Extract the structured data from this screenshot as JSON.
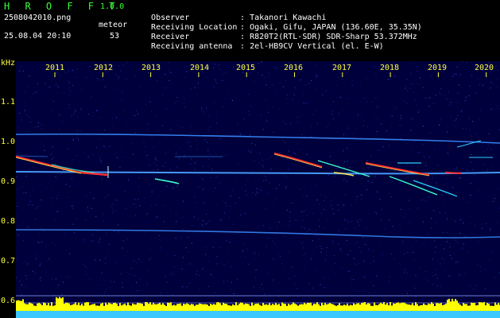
{
  "header": {
    "app_title": "H R O F F T",
    "app_version": "1.0.0",
    "filename": "2508042010.png",
    "datetime": "25.08.04 20:10",
    "meteor_label": "meteor",
    "meteor_count": "53"
  },
  "info": [
    {
      "label": "Observer",
      "value": "Takanori Kawachi"
    },
    {
      "label": "Receiving Location",
      "value": "Ogaki, Gifu, JAPAN (136.60E, 35.35N)"
    },
    {
      "label": "Receiver",
      "value": "R820T2(RTL-SDR) SDR-Sharp 53.372MHz"
    },
    {
      "label": "Receiving antenna",
      "value": "2el-HB9CV Vertical (el. E-W)"
    }
  ],
  "plot": {
    "y_unit": "kHz",
    "y_ticks": [
      {
        "label": "1.1",
        "value": 1.1
      },
      {
        "label": "1.0",
        "value": 1.0
      },
      {
        "label": "0.9",
        "value": 0.9
      },
      {
        "label": "0.8",
        "value": 0.8
      },
      {
        "label": "0.7",
        "value": 0.7
      },
      {
        "label": "0.6",
        "value": 0.6
      }
    ],
    "x_ticks": [
      "2011",
      "2012",
      "2013",
      "2014",
      "2015",
      "2016",
      "2017",
      "2018",
      "2019",
      "2020"
    ],
    "colors": {
      "background": "#00003c",
      "tick_text": "#ffff3c",
      "carrier": "#3a8cff",
      "meteor_hot": "#ff3030",
      "meteor_warm": "#ffe94a",
      "meteor_cool": "#3cffd0",
      "level_bar": "#ffff00",
      "level_base": "#3ac8ff"
    }
  }
}
